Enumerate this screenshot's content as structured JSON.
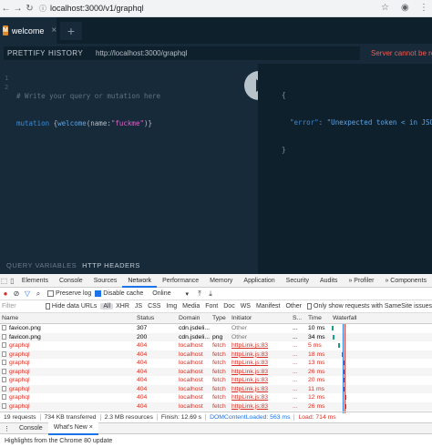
{
  "browser": {
    "url": "localhost:3000/v1/graphql"
  },
  "playground": {
    "tab_badge": "M",
    "tab_label": "welcome",
    "tab_close": "×",
    "add_tab": "+",
    "prettify": "PRETTIFY",
    "history": "HISTORY",
    "endpoint": "http://localhost:3000/graphql",
    "error_banner": "Server cannot be re",
    "gutter": [
      "1",
      "2"
    ],
    "code_comment": "# Write your query or mutation here",
    "code_kw": "mutation",
    "code_brace_open": " {",
    "code_field": "welcome",
    "code_arg": "(name:",
    "code_str": "\"fuckme\"",
    "code_close": ")}",
    "result_open": "{",
    "result_key": "\"error\"",
    "result_colon": ": ",
    "result_val": "\"Unexpected token < in JSO",
    "result_close": "}",
    "query_variables": "QUERY VARIABLES",
    "http_headers": "HTTP HEADERS"
  },
  "devtools": {
    "tabs": [
      "Elements",
      "Console",
      "Sources",
      "Network",
      "Performance",
      "Memory",
      "Application",
      "Security",
      "Audits",
      "» Profiler",
      "» Components"
    ],
    "active_tab": "Network",
    "toolbar": {
      "preserve_log": "Preserve log",
      "disable_cache": "Disable cache",
      "throttling": "Online"
    },
    "filter": {
      "placeholder": "Filter",
      "hide_data_urls": "Hide data URLs",
      "types": [
        "All",
        "XHR",
        "JS",
        "CSS",
        "Img",
        "Media",
        "Font",
        "Doc",
        "WS",
        "Manifest",
        "Other"
      ],
      "samesite": "Only show requests with SameSite issues"
    },
    "columns": [
      "Name",
      "Status",
      "Domain",
      "Type",
      "Initiator",
      "S...",
      "Time",
      "Waterfall"
    ],
    "rows": [
      {
        "name": "favicon.png",
        "status": "307",
        "domain": "cdn.jsdeli...",
        "type": "",
        "initiator": "Other",
        "size": "...",
        "time": "10 ms",
        "error": false
      },
      {
        "name": "favicon.png",
        "status": "200",
        "domain": "cdn.jsdeli...",
        "type": "png",
        "initiator": "Other",
        "size": "...",
        "time": "34 ms",
        "error": false
      },
      {
        "name": "graphql",
        "status": "404",
        "domain": "localhost",
        "type": "fetch",
        "initiator": "httpLink.js:83",
        "size": "...",
        "time": "5 ms",
        "error": true
      },
      {
        "name": "graphql",
        "status": "404",
        "domain": "localhost",
        "type": "fetch",
        "initiator": "httpLink.js:83",
        "size": "...",
        "time": "18 ms",
        "error": true
      },
      {
        "name": "graphql",
        "status": "404",
        "domain": "localhost",
        "type": "fetch",
        "initiator": "httpLink.js:83",
        "size": "...",
        "time": "13 ms",
        "error": true
      },
      {
        "name": "graphql",
        "status": "404",
        "domain": "localhost",
        "type": "fetch",
        "initiator": "httpLink.js:83",
        "size": "...",
        "time": "26 ms",
        "error": true
      },
      {
        "name": "graphql",
        "status": "404",
        "domain": "localhost",
        "type": "fetch",
        "initiator": "httpLink.js:83",
        "size": "...",
        "time": "20 ms",
        "error": true
      },
      {
        "name": "graphql",
        "status": "404",
        "domain": "localhost",
        "type": "fetch",
        "initiator": "httpLink.js:83",
        "size": "...",
        "time": "11 ms",
        "error": true
      },
      {
        "name": "graphql",
        "status": "404",
        "domain": "localhost",
        "type": "fetch",
        "initiator": "httpLink.js:83",
        "size": "...",
        "time": "12 ms",
        "error": true
      },
      {
        "name": "graphql",
        "status": "404",
        "domain": "localhost",
        "type": "fetch",
        "initiator": "httpLink.js:83",
        "size": "...",
        "time": "26 ms",
        "error": true
      }
    ],
    "summary": {
      "requests": "19 requests",
      "transferred": "734 KB transferred",
      "resources": "2.3 MB resources",
      "finish": "Finish: 12.69 s",
      "dcl": "DOMContentLoaded: 563 ms",
      "load": "Load: 714 ms"
    },
    "drawer": {
      "tabs": [
        "Console",
        "What's New ×"
      ],
      "highlights": "Highlights from the Chrome 80 update"
    }
  },
  "colors": {
    "playground_bg": "#172a3a",
    "accent_badge": "#da8a2b",
    "error": "#d93025",
    "link_blue": "#1a73e8"
  }
}
